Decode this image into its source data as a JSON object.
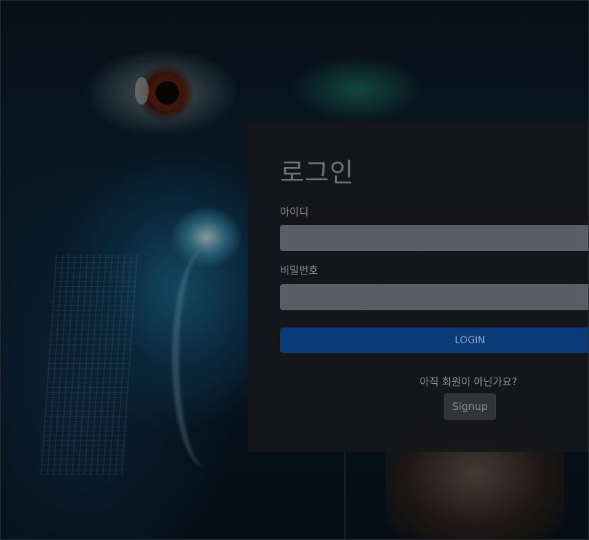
{
  "login": {
    "title": "로그인",
    "id_label": "아이디",
    "id_value": "",
    "password_label": "비밀번호",
    "password_value": "",
    "login_button": "LOGIN",
    "signup_prompt": "아직 회원이 아닌가요?",
    "signup_button": "Signup"
  },
  "colors": {
    "card_background": "#16171a",
    "input_background": "#5a5d61",
    "login_button": "#0b3a78",
    "signup_button": "#323438",
    "label_text": "#8a8d91"
  }
}
